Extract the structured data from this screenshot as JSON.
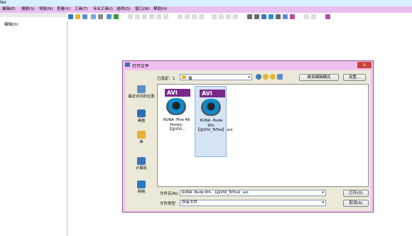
{
  "window": {
    "title": "lex"
  },
  "menu": [
    {
      "label": "编辑(E)"
    },
    {
      "label": "搜索(S)"
    },
    {
      "label": "导航(N)"
    },
    {
      "label": "查看(V)"
    },
    {
      "label": "工具(T)"
    },
    {
      "label": "专业工具(I)"
    },
    {
      "label": "选项(O)"
    },
    {
      "label": "窗口(W)"
    },
    {
      "label": "帮助(H)"
    }
  ],
  "left_panel": {
    "edit_label": "编辑(D)"
  },
  "toolbar_colors": {
    "active": [
      "#3a7ab8",
      "#e6b530",
      "#5c8fd1",
      "#7aa6d8",
      "#8a8a8a",
      "#5c8fd1",
      "#3a9a3a"
    ],
    "disabled": "#9a9a9a",
    "right": [
      "#6a6a6a",
      "#6a6a6a",
      "#3a7ab8",
      "#2f8fd8",
      "#6a6a6a",
      "#5c8fd1",
      "#b04ea8"
    ]
  },
  "dialog": {
    "title": "打开文件",
    "close": "x",
    "lookin_label": "已选定：1",
    "lookin_value": "猫",
    "view_mode_button": "故资编辑模式",
    "settings_button": "设置...",
    "places": [
      {
        "label": "最近访问的位置",
        "icon": "recent-places-icon",
        "color": "#5b8fc9"
      },
      {
        "label": "桌面",
        "icon": "desktop-icon",
        "color": "#2f6eb5"
      },
      {
        "label": "库",
        "icon": "libraries-icon",
        "color": "#e3b13a"
      },
      {
        "label": "计算机",
        "icon": "computer-icon",
        "color": "#3d76b9"
      },
      {
        "label": "网络",
        "icon": "network-icon",
        "color": "#2a7ac0"
      }
    ],
    "files": [
      {
        "badge": "AVI",
        "name": "RUNA -Fine 48 Honey- 【@ViVi...",
        "selected": false
      },
      {
        "badge": "AVI",
        "name": "RUNA -Nude 9th- 【@ViVi_ToToo】.avi",
        "selected": true
      }
    ],
    "filename_label": "文件名(N):",
    "filename_value": "RUNA -Nude 9th- 【@ViVi_ToToo】.avi",
    "filetype_label": "文件类型",
    "filetype_value": "所有文件",
    "open_button": "打开(O)",
    "cancel_button": "取消(A)"
  }
}
